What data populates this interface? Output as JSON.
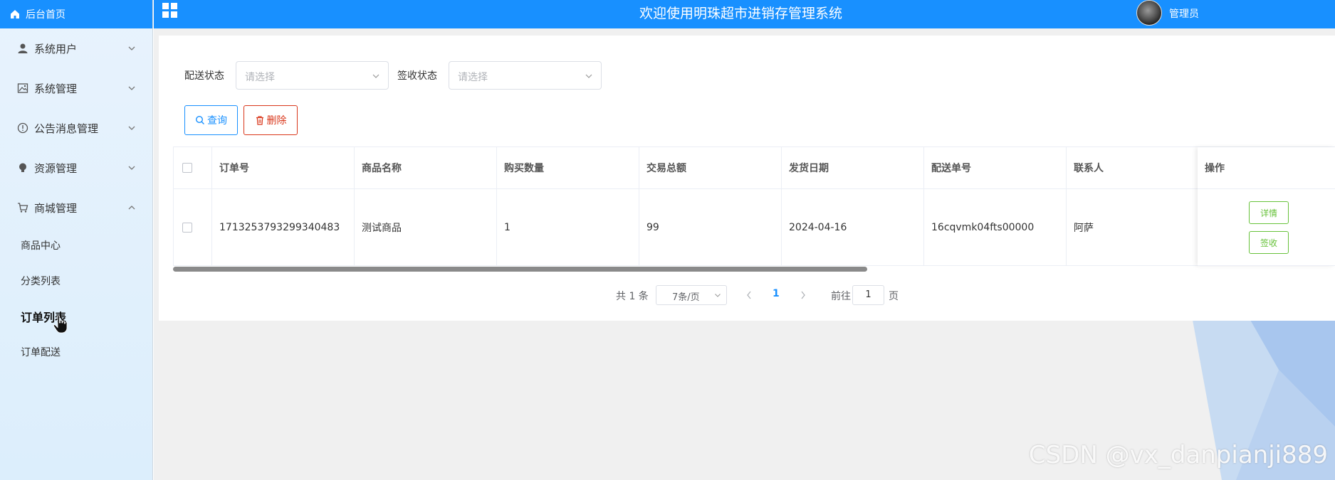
{
  "topbar": {
    "title": "欢迎使用明珠超市进销存管理系统",
    "user_name": "管理员"
  },
  "sidebar": {
    "home_label": "后台首页",
    "menus": [
      {
        "label": "系统用户",
        "icon": "user-icon"
      },
      {
        "label": "系统管理",
        "icon": "picture-icon"
      },
      {
        "label": "公告消息管理",
        "icon": "info-icon"
      },
      {
        "label": "资源管理",
        "icon": "bulb-icon"
      },
      {
        "label": "商城管理",
        "icon": "cart-icon"
      }
    ],
    "submenu": [
      "商品中心",
      "分类列表",
      "订单列表",
      "订单配送"
    ],
    "active_submenu": "订单列表"
  },
  "filters": {
    "delivery_label": "配送状态",
    "delivery_placeholder": "请选择",
    "signed_label": "签收状态",
    "signed_placeholder": "请选择"
  },
  "buttons": {
    "query": "查询",
    "delete": "删除"
  },
  "table": {
    "headers": [
      "订单号",
      "商品名称",
      "购买数量",
      "交易总额",
      "发货日期",
      "配送单号",
      "联系人",
      "操作"
    ],
    "rows": [
      [
        "1713253793299340483",
        "测试商品",
        "1",
        "99",
        "2024-04-16",
        "16cqvmk04fts00000",
        "阿萨"
      ]
    ],
    "actions": [
      "详情",
      "签收"
    ]
  },
  "pagination": {
    "total": "共 1 条",
    "page_size": "7条/页",
    "current": "1",
    "goto_prefix": "前往",
    "goto_value": "1",
    "goto_suffix": "页"
  },
  "watermark": "CSDN @vx_danpianji889",
  "colors": {
    "primary": "#1890ff",
    "danger": "#d9361a",
    "success": "#67c23a"
  }
}
